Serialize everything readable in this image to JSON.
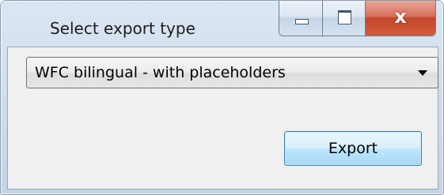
{
  "window": {
    "title": "Select export type",
    "controls": {
      "minimize_icon": "minimize-icon",
      "maximize_icon": "maximize-icon",
      "close_glyph": "x"
    }
  },
  "form": {
    "export_type": {
      "selected": "WFC bilingual - with placeholders"
    },
    "export_button_label": "Export"
  },
  "colors": {
    "close_button": "#c5452b",
    "default_button_border": "#3c7fb1"
  }
}
